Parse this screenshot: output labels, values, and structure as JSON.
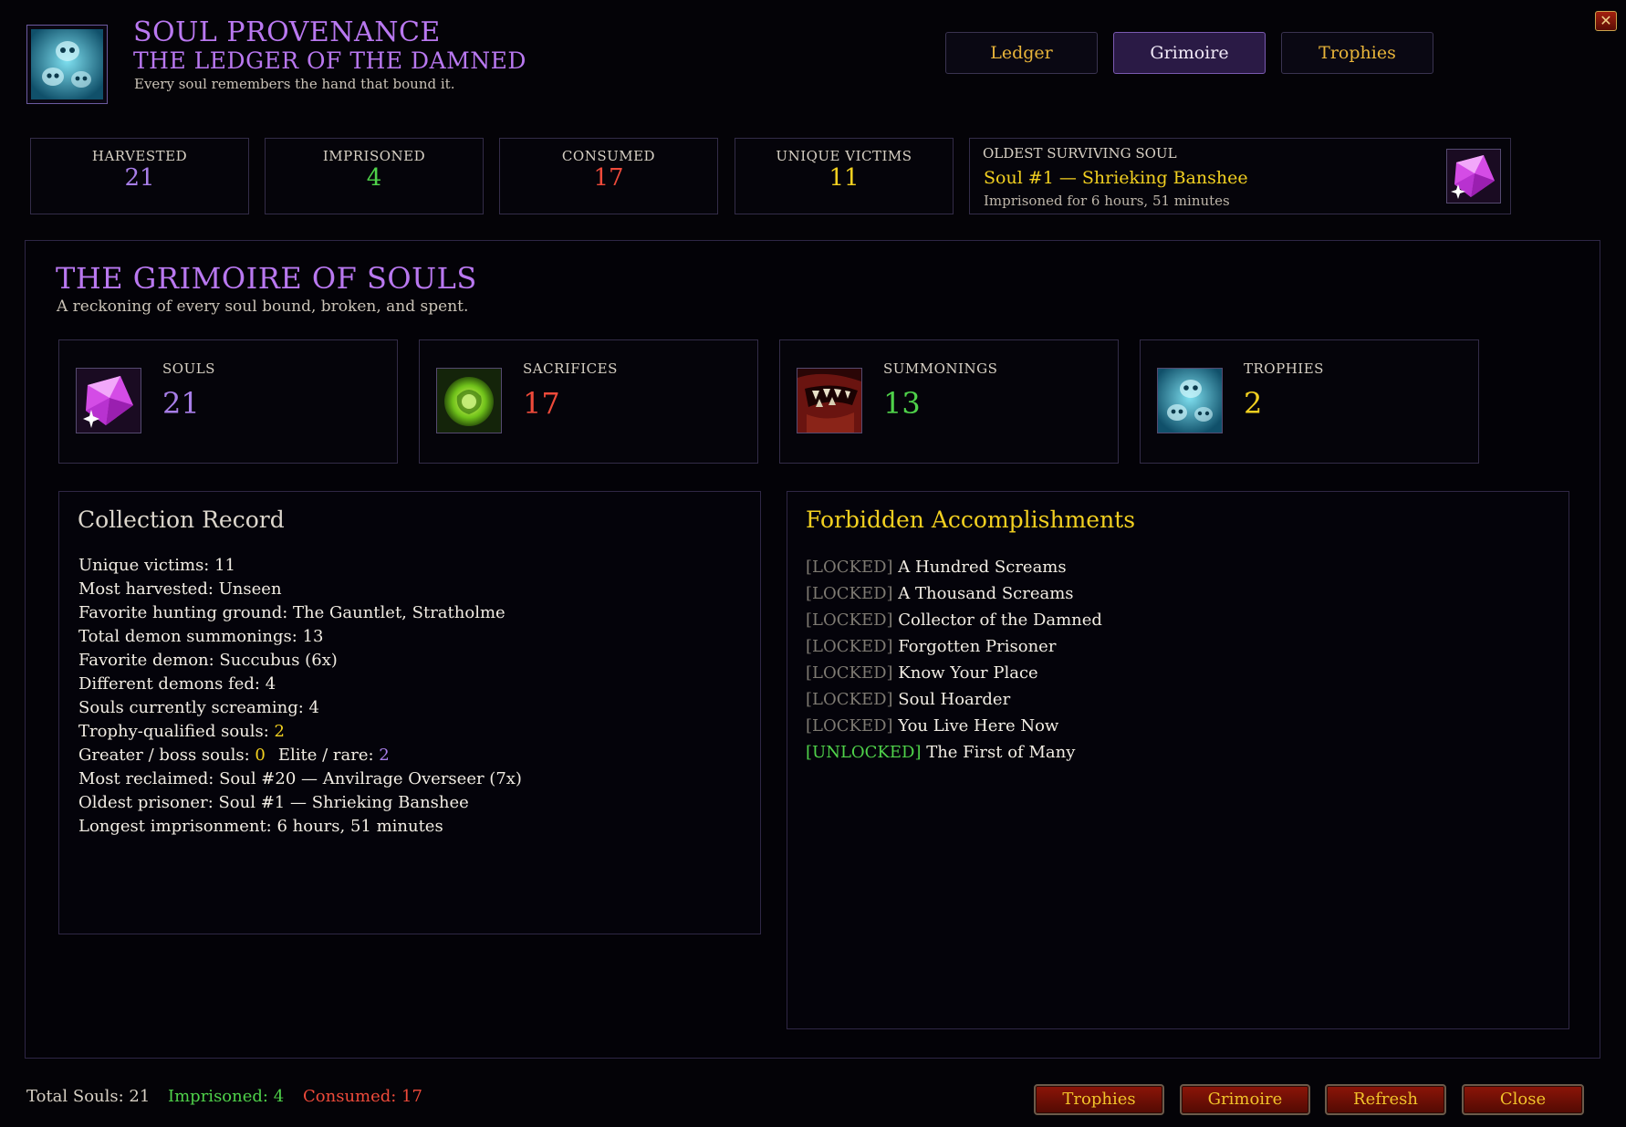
{
  "header": {
    "title": "SOUL PROVENANCE",
    "subtitle": "THE LEDGER OF THE DAMNED",
    "tagline": "Every soul remembers the hand that bound it.",
    "close_glyph": "✕"
  },
  "tabs": [
    {
      "label": "Ledger",
      "active": false
    },
    {
      "label": "Grimoire",
      "active": true
    },
    {
      "label": "Trophies",
      "active": false
    }
  ],
  "stats": [
    {
      "label": "HARVESTED",
      "value": "21",
      "color": "#a87ee8"
    },
    {
      "label": "IMPRISONED",
      "value": "4",
      "color": "#4fd24a"
    },
    {
      "label": "CONSUMED",
      "value": "17",
      "color": "#ee4a3a"
    },
    {
      "label": "UNIQUE VICTIMS",
      "value": "11",
      "color": "#f2d020"
    }
  ],
  "oldest": {
    "label": "OLDEST SURVIVING SOUL",
    "name": "Soul #1 — Shrieking Banshee",
    "duration": "Imprisoned for 6 hours, 51 minutes",
    "icon": "soul-gem-icon"
  },
  "grimoire": {
    "title": "THE GRIMOIRE OF SOULS",
    "subtitle": "A reckoning of every soul bound, broken, and spent.",
    "cards": [
      {
        "label": "SOULS",
        "value": "21",
        "color": "#a87ee8",
        "icon": "soul-gem-icon"
      },
      {
        "label": "SACRIFICES",
        "value": "17",
        "color": "#ee4a3a",
        "icon": "fel-orb-icon"
      },
      {
        "label": "SUMMONINGS",
        "value": "13",
        "color": "#4fd24a",
        "icon": "demon-maw-icon"
      },
      {
        "label": "TROPHIES",
        "value": "2",
        "color": "#f2d020",
        "icon": "skulls-icon"
      }
    ]
  },
  "collection": {
    "title": "Collection Record",
    "lines": {
      "unique_victims": "Unique victims: 11",
      "most_harvested": "Most harvested: Unseen",
      "hunting_ground": "Favorite hunting ground: The Gauntlet, Stratholme",
      "summonings": "Total demon summonings: 13",
      "favorite_demon": "Favorite demon: Succubus (6x)",
      "demons_fed": "Different demons fed: 4",
      "screaming": "Souls currently screaming: 4",
      "trophy_label": "Trophy-qualified souls: ",
      "trophy_value": "2",
      "greater_label": "Greater / boss souls: ",
      "greater_value": "0",
      "elite_label": "Elite / rare: ",
      "elite_value": "2",
      "most_reclaimed": "Most reclaimed: Soul #20 — Anvilrage Overseer (7x)",
      "oldest_prisoner": "Oldest prisoner: Soul #1 — Shrieking Banshee",
      "longest": "Longest imprisonment: 6 hours, 51 minutes"
    }
  },
  "accomplishments": {
    "title": "Forbidden Accomplishments",
    "items": [
      {
        "status": "[LOCKED]",
        "name": "A Hundred Screams",
        "unlocked": false
      },
      {
        "status": "[LOCKED]",
        "name": "A Thousand Screams",
        "unlocked": false
      },
      {
        "status": "[LOCKED]",
        "name": "Collector of the Damned",
        "unlocked": false
      },
      {
        "status": "[LOCKED]",
        "name": "Forgotten Prisoner",
        "unlocked": false
      },
      {
        "status": "[LOCKED]",
        "name": "Know Your Place",
        "unlocked": false
      },
      {
        "status": "[LOCKED]",
        "name": "Soul Hoarder",
        "unlocked": false
      },
      {
        "status": "[LOCKED]",
        "name": "You Live Here Now",
        "unlocked": false
      },
      {
        "status": "[UNLOCKED]",
        "name": "The First of Many",
        "unlocked": true
      }
    ]
  },
  "footer": {
    "total": "Total Souls: 21",
    "imprisoned": "Imprisoned: 4",
    "consumed": "Consumed: 17",
    "buttons": [
      "Trophies",
      "Grimoire",
      "Refresh",
      "Close"
    ]
  }
}
